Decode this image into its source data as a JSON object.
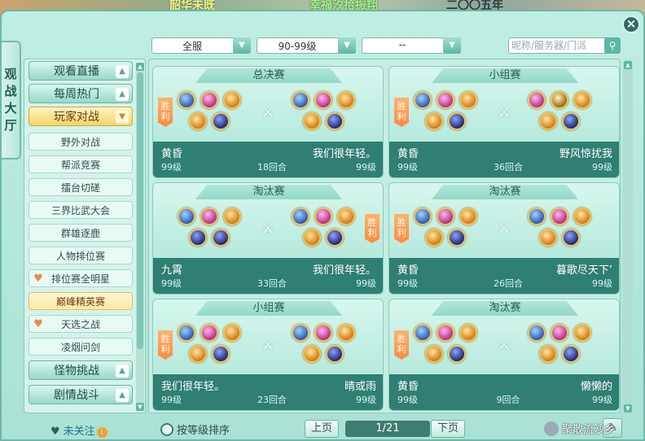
{
  "top_strip": {
    "text1": "韶华未既",
    "text2": "幸福汐拾振翔",
    "text3": "二〇〇五年"
  },
  "window": {
    "title_chars": [
      "观",
      "战",
      "大",
      "厅"
    ],
    "close_label": "×"
  },
  "filters": {
    "server": "全服",
    "level": "90-99级",
    "third": "--",
    "search_placeholder": "昵称/服务器/门派",
    "search_icon": "search-icon"
  },
  "sidebar": {
    "categories": {
      "live": "观看直播",
      "weekly": "每周热门",
      "pvp": "玩家对战",
      "monster": "怪物挑战",
      "story": "剧情战斗"
    },
    "sub_items": [
      "野外对战",
      "帮派竞赛",
      "擂台切磋",
      "三界比武大会",
      "群雄逐鹿",
      "人物排位赛",
      "排位赛全明星",
      "巅峰精英赛",
      "天选之战",
      "凌烟问剑"
    ],
    "selected_sub": "巅峰精英赛"
  },
  "win_label": "胜利",
  "matches": [
    {
      "title": "总决赛",
      "left_name": "黄昏",
      "left_level": "99级",
      "right_name": "我们很年轻。",
      "right_level": "99级",
      "rounds": "18回合",
      "winner": "left"
    },
    {
      "title": "小组赛",
      "left_name": "黄昏",
      "left_level": "99级",
      "right_name": "野风惊扰我",
      "right_level": "99级",
      "rounds": "36回合",
      "winner": "left"
    },
    {
      "title": "淘汰赛",
      "left_name": "九霄",
      "left_level": "99级",
      "right_name": "我们很年轻。",
      "right_level": "99级",
      "rounds": "33回合",
      "winner": "right"
    },
    {
      "title": "淘汰赛",
      "left_name": "黄昏",
      "left_level": "99级",
      "right_name": "暮歌尽天下’",
      "right_level": "99级",
      "rounds": "26回合",
      "winner": "left"
    },
    {
      "title": "小组赛",
      "left_name": "我们很年轻。",
      "left_level": "99级",
      "right_name": "晴或雨",
      "right_level": "99级",
      "rounds": "23回合",
      "winner": "left"
    },
    {
      "title": "淘汰赛",
      "left_name": "黄昏",
      "left_level": "99级",
      "right_name": "懒懒的",
      "right_level": "99级",
      "rounds": "9回合",
      "winner": "left"
    }
  ],
  "bottom": {
    "follow_label": "未关注",
    "sort_label": "按等级排序",
    "prev_label": "上页",
    "page_indicator": "1/21",
    "next_label": "下页"
  },
  "watermark": "聚散流沙乡",
  "colors": {
    "accent": "#2f7f72",
    "win_tag": "#ff8a3d",
    "selected_category": "#f5d46a"
  }
}
